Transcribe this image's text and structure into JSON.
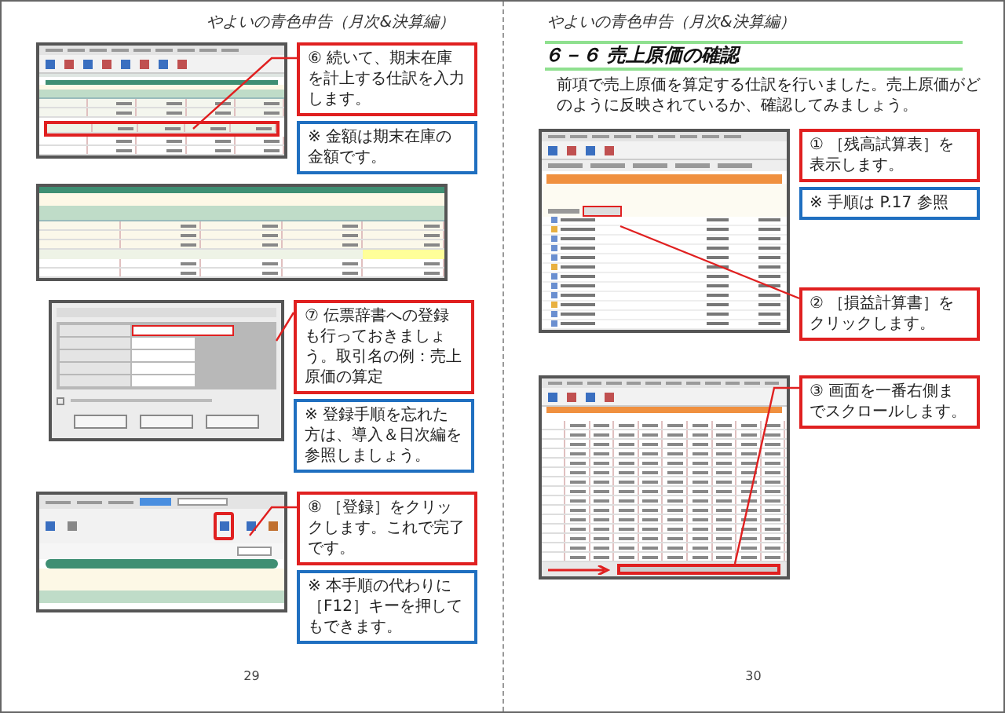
{
  "left_page": {
    "header": "やよいの青色申告（月次&決算編）",
    "blocks": [
      {
        "kind": "journal",
        "callouts": [
          {
            "kind": "step",
            "text": "⑥ 続いて、期末在庫を計上する仕訳を入力します。"
          },
          {
            "kind": "note",
            "text": "※ 金額は期末在庫の金額です。"
          }
        ]
      },
      {
        "kind": "ledger"
      },
      {
        "kind": "dialog",
        "callouts": [
          {
            "kind": "step",
            "text": "⑦ 伝票辞書への登録も行っておきましょう。取引名の例：売上原価の算定"
          },
          {
            "kind": "note",
            "text": "※ 登録手順を忘れた方は、導入＆日次編を参照しましょう。"
          }
        ]
      },
      {
        "kind": "toolbar",
        "callouts": [
          {
            "kind": "step",
            "text": "⑧ ［登録］をクリックします。これで完了です。"
          },
          {
            "kind": "note",
            "text": "※ 本手順の代わりに［F12］キーを押してもできます。"
          }
        ]
      }
    ],
    "page_number": "29"
  },
  "right_page": {
    "header": "やよいの青色申告（月次&決算編）",
    "title": "６－６ 売上原価の確認",
    "intro": "前項で売上原価を算定する仕訳を行いました。売上原価がどのように反映されているか、確認してみましょう。",
    "blocks": [
      {
        "kind": "trial",
        "callouts": [
          {
            "kind": "step",
            "text": "① ［残高試算表］を表示します。"
          },
          {
            "kind": "note",
            "text": "※ 手順は P.17 参照"
          },
          {
            "kind": "step",
            "text": "② ［損益計算書］をクリックします。"
          }
        ]
      },
      {
        "kind": "wide",
        "callouts": [
          {
            "kind": "step",
            "text": "③ 画面を一番右側までスクロールします。"
          }
        ]
      }
    ],
    "page_number": "30"
  }
}
